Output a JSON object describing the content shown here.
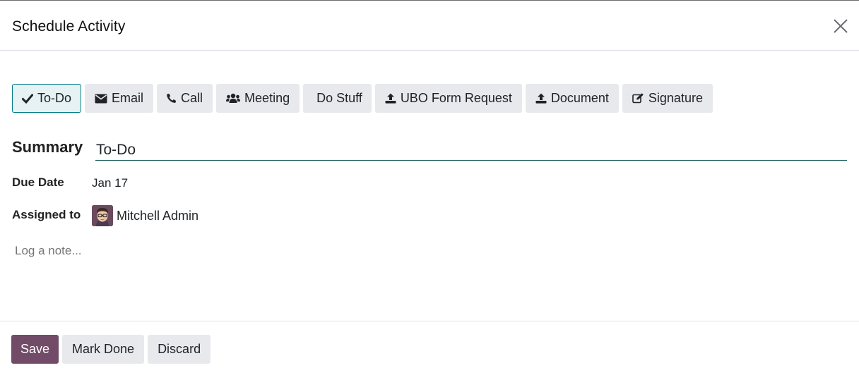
{
  "dialog": {
    "title": "Schedule Activity"
  },
  "activity_types": [
    {
      "label": "To-Do",
      "icon": "check-icon",
      "active": true
    },
    {
      "label": "Email",
      "icon": "envelope-icon",
      "active": false
    },
    {
      "label": "Call",
      "icon": "phone-icon",
      "active": false
    },
    {
      "label": "Meeting",
      "icon": "users-icon",
      "active": false
    },
    {
      "label": "Do Stuff",
      "icon": "",
      "active": false
    },
    {
      "label": "UBO Form Request",
      "icon": "upload-icon",
      "active": false
    },
    {
      "label": "Document",
      "icon": "upload-icon",
      "active": false
    },
    {
      "label": "Signature",
      "icon": "pencil-square-icon",
      "active": false
    }
  ],
  "form": {
    "summary_label": "Summary",
    "summary_value": "To-Do",
    "due_date_label": "Due Date",
    "due_date_value": "Jan 17",
    "assigned_label": "Assigned to",
    "assigned_name": "Mitchell Admin",
    "note_placeholder": "Log a note..."
  },
  "footer": {
    "save_label": "Save",
    "mark_done_label": "Mark Done",
    "discard_label": "Discard"
  },
  "colors": {
    "primary": "#714b67",
    "active_border": "#017e84",
    "button_bg": "#e7e9ed"
  }
}
